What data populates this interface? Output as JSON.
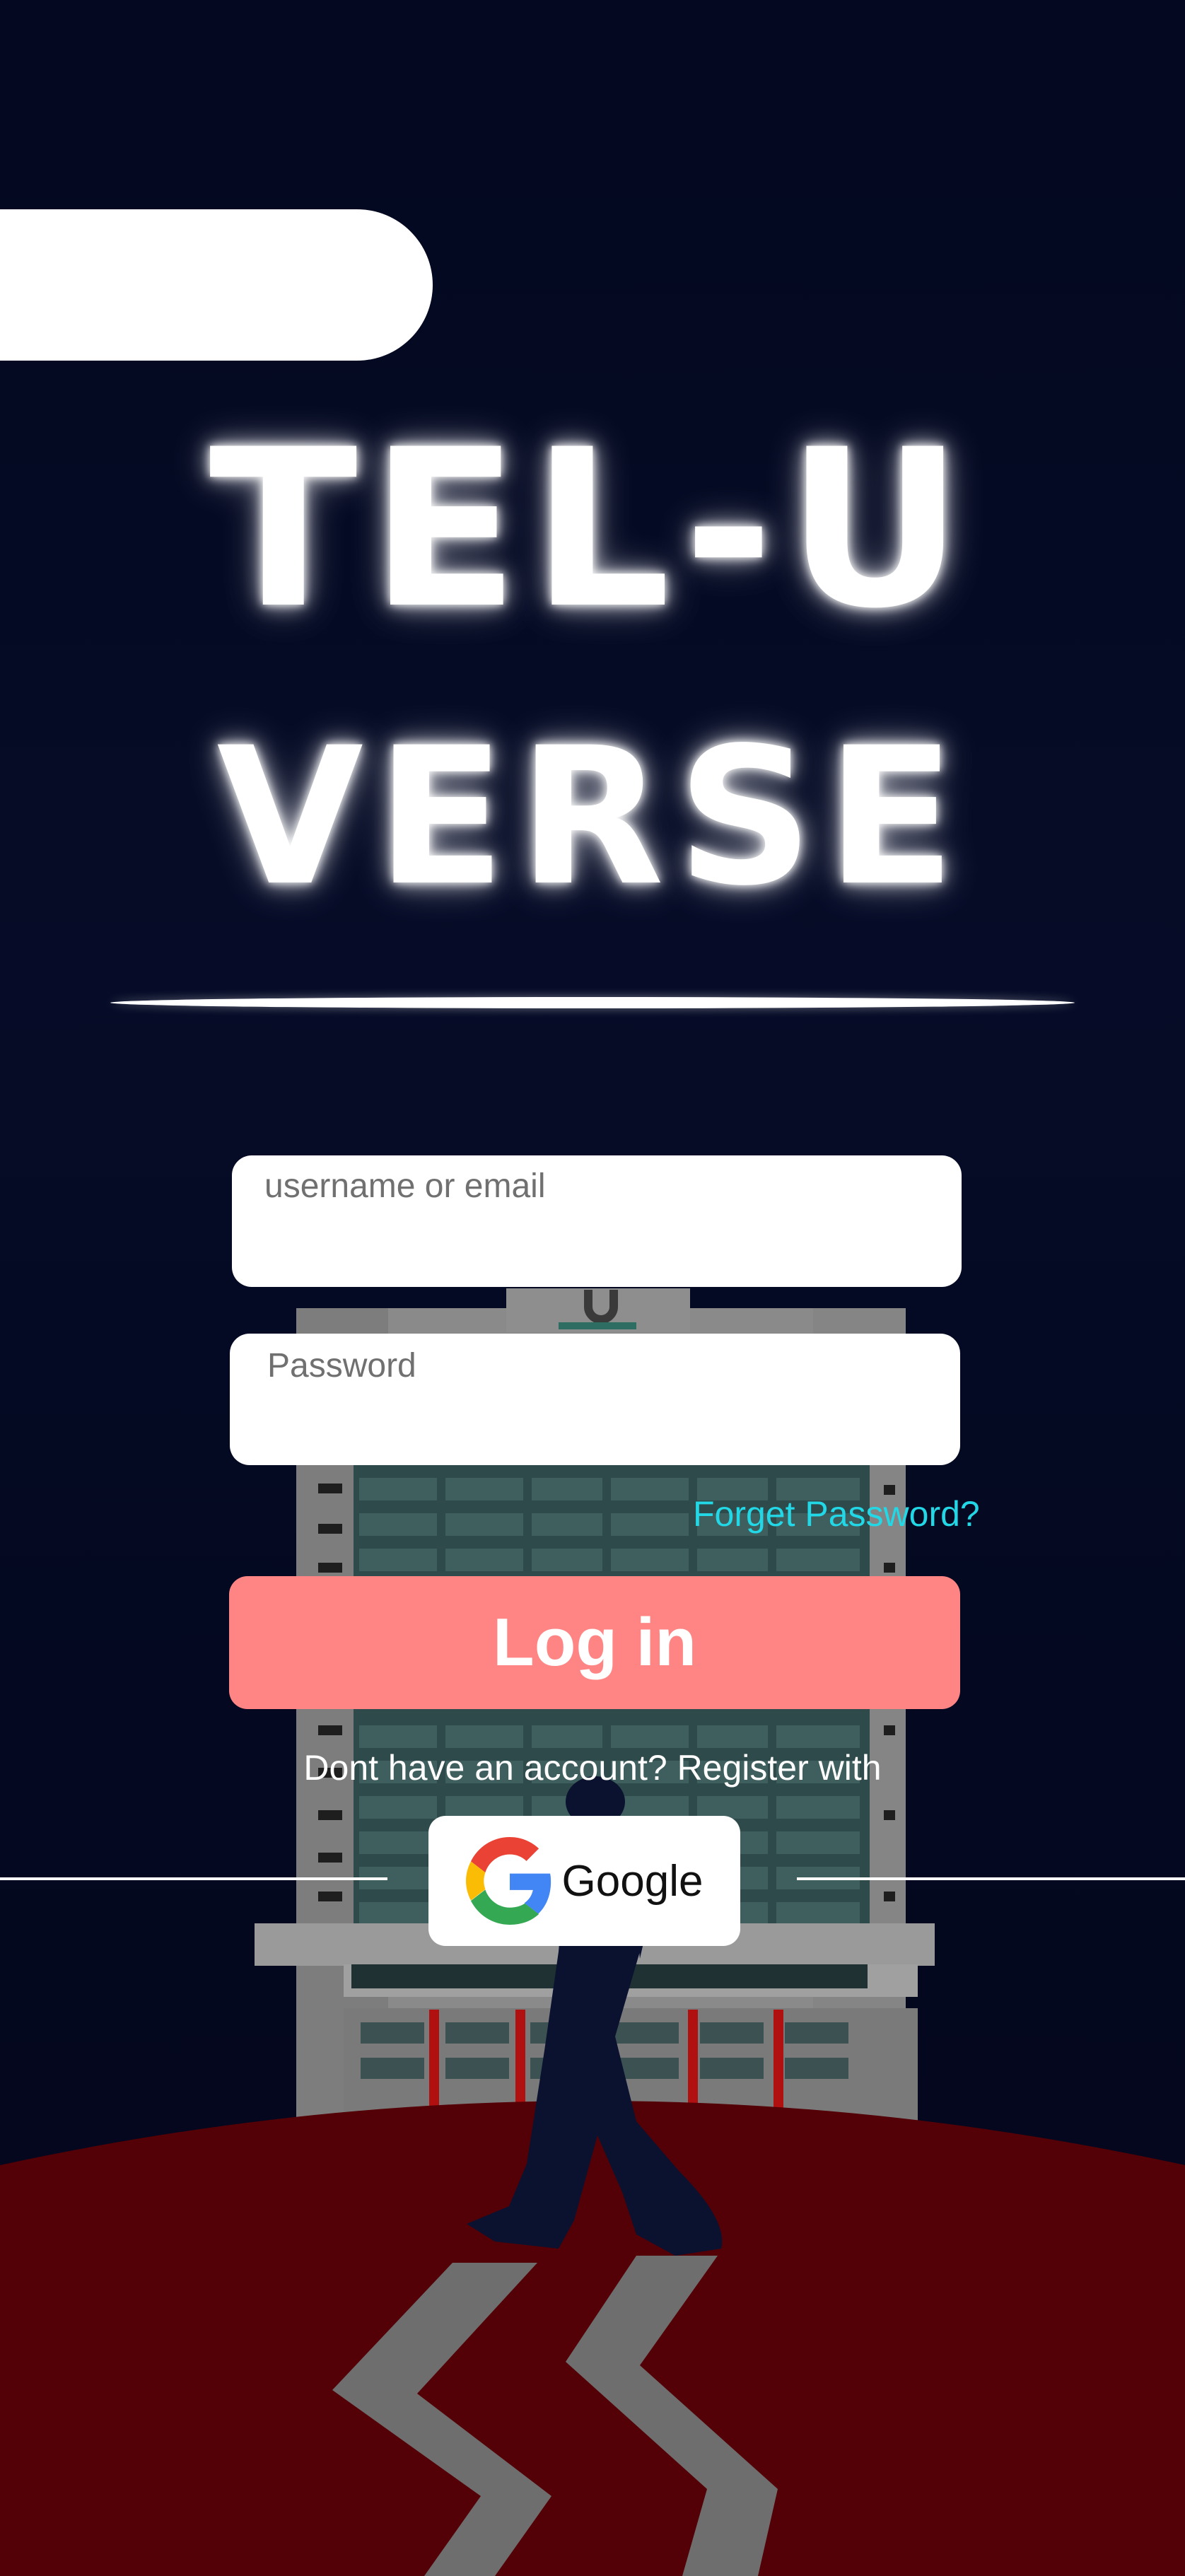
{
  "app": {
    "logo_line1": "TEL-U",
    "logo_line2": "VERSE"
  },
  "form": {
    "username_placeholder": "username or email",
    "password_placeholder": "Password",
    "forget_password": "Forget Password?",
    "login_label": "Log in",
    "register_prompt": "Dont have an account? Register with",
    "google_label": "Google"
  },
  "colors": {
    "background": "#040820",
    "accent_button": "#ff8585",
    "link": "#22d8e6",
    "ground": "#530006"
  },
  "icons": {
    "google": "google-g-icon"
  }
}
